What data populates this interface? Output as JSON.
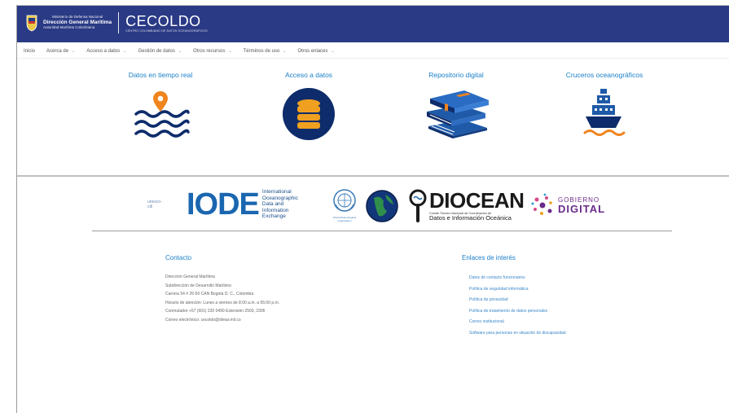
{
  "header": {
    "ministry": "Ministerio de Defensa Nacional",
    "dimar_title": "Dirección General Marítima",
    "dimar_subtitle": "Autoridad Marítima Colombiana",
    "brand_name": "CECOLDO",
    "brand_subtitle": "CENTRO COLOMBIANO DE DATOS OCEANOGRÁFICOS"
  },
  "nav": [
    {
      "label": "Inicio",
      "dropdown": false
    },
    {
      "label": "Acerca de",
      "dropdown": true
    },
    {
      "label": "Acceso a datos",
      "dropdown": true
    },
    {
      "label": "Gestión de datos",
      "dropdown": true
    },
    {
      "label": "Otros recursos",
      "dropdown": true
    },
    {
      "label": "Términos de uso",
      "dropdown": true
    },
    {
      "label": "Otros enlaces",
      "dropdown": true
    }
  ],
  "features": [
    {
      "title": "Datos en tiempo real",
      "icon": "realtime-waves-icon"
    },
    {
      "title": "Acceso a datos",
      "icon": "database-icon"
    },
    {
      "title": "Repositorio digital",
      "icon": "books-icon"
    },
    {
      "title": "Cruceros oceanográficos",
      "icon": "ship-icon"
    }
  ],
  "partners": {
    "broken_alt": "unesco-cdi",
    "iode_word": "IODE",
    "iode_text": [
      "International",
      "Oceanographic",
      "Data and Information",
      "Exchange"
    ],
    "wmo_text": [
      "World Meteorological",
      "Organization"
    ],
    "diocean_word": "DIOCEAN",
    "diocean_sub1": "Comité Técnico Nacional de Coordinación de",
    "diocean_sub2": "Datos e Información Oceánica",
    "gob_line1": "GOBIERNO",
    "gob_line2": "DIGITAL"
  },
  "contact": {
    "heading": "Contacto",
    "lines": [
      "Dirección General Marítima",
      "Subdirección de Desarrollo Marítimo",
      "Carrera 54 # 26-50 CAN Bogotá D. C., Colombia",
      "Horario de atención: Lunes a viernes de 8:00 a.m. a 05:00 p.m.",
      "Conmutador +57 (601) 220 0490 Extensión 2503, 2306",
      "Correo electrónico: cecoldo@dimar.mil.co"
    ]
  },
  "links": {
    "heading": "Enlaces de interés",
    "items": [
      "Datos de contacto funcionarios",
      "Política de seguridad informática",
      "Política de privacidad",
      "Política de tratamiento de datos personales",
      "Correo institucional",
      "Software para personas en situación de discapacidad"
    ]
  },
  "colors": {
    "header_bg": "#2a3a85",
    "accent_blue": "#1a7fc8",
    "icon_navy": "#0e2c6b",
    "icon_orange": "#f0841e"
  }
}
